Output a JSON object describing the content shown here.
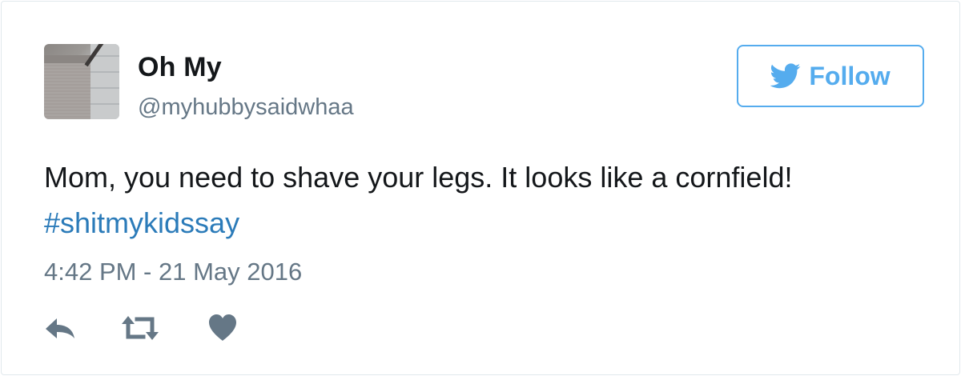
{
  "author": {
    "name": "Oh My",
    "handle": "@myhubbysaidwhaa"
  },
  "follow_button": {
    "label": "Follow",
    "icon": "twitter-bird-icon"
  },
  "tweet": {
    "text": "Mom, you need to shave your legs. It looks like a cornfield!",
    "hashtag": "#shitmykidssay",
    "timestamp": "4:42 PM - 21 May 2016"
  },
  "actions": [
    {
      "name": "reply",
      "icon": "reply-icon"
    },
    {
      "name": "retweet",
      "icon": "retweet-icon"
    },
    {
      "name": "like",
      "icon": "heart-icon"
    }
  ],
  "colors": {
    "accent": "#55acee",
    "hashtag": "#2b7bb9",
    "text": "#14171a",
    "muted": "#657786",
    "icon": "#657786",
    "border": "#e1e8ed"
  }
}
